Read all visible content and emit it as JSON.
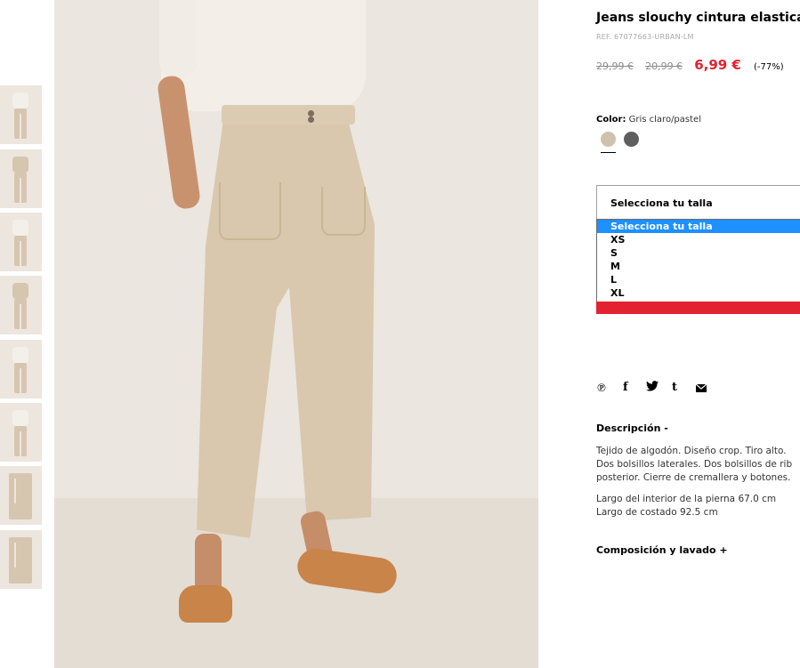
{
  "product": {
    "title": "Jeans slouchy cintura elastica",
    "reference": "REF. 67077663-URBAN-LM",
    "prices": {
      "original": "29,99 €",
      "previous": "20,99 €",
      "current": "6,99 €",
      "discount": "(-77%)"
    },
    "color": {
      "label": "Color:",
      "value": "Gris claro/pastel",
      "swatches": [
        {
          "name": "beige",
          "hex": "#cfc2ac",
          "selected": true
        },
        {
          "name": "gris-oscuro",
          "hex": "#5e5e5e",
          "selected": false
        }
      ]
    },
    "size": {
      "select_label": "Selecciona tu talla",
      "options": [
        "Selecciona tu talla",
        "XS",
        "S",
        "M",
        "L",
        "XL"
      ],
      "highlighted_index": 0
    },
    "share": {
      "icons": [
        "pinterest-icon",
        "facebook-icon",
        "twitter-icon",
        "tumblr-icon",
        "email-icon"
      ],
      "glyphs": [
        "℗",
        "f",
        "🐦",
        "t",
        "✉"
      ]
    },
    "description": {
      "heading": "Descripción -",
      "lines": [
        "Tejido de algodón. Diseño crop. Tiro alto.",
        "Dos bolsillos laterales. Dos bolsillos de rib",
        "posterior. Cierre de cremallera y botones."
      ],
      "measures": [
        "Largo del interior de la pierna 67.0 cm",
        "Largo de costado 92.5 cm"
      ]
    },
    "composition": {
      "heading": "Composición y lavado +"
    }
  },
  "colors": {
    "accent_red": "#e2222f",
    "dropdown_highlight": "#1e90ff"
  }
}
